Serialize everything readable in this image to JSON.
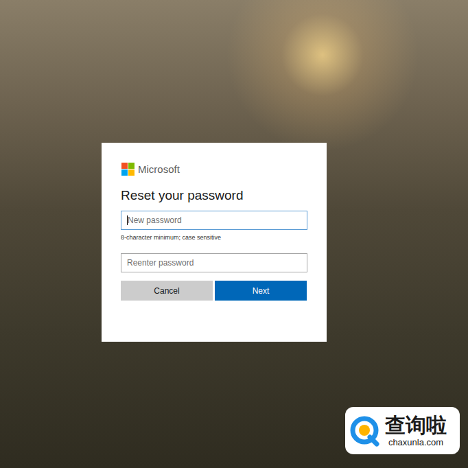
{
  "brand": "Microsoft",
  "title": "Reset your password",
  "fields": [
    {
      "placeholder": "New password",
      "hint": "8-character minimum; case sensitive",
      "focused": true
    },
    {
      "placeholder": "Reenter password",
      "hint": "",
      "focused": false
    }
  ],
  "buttons": [
    {
      "label": "Cancel",
      "primary": false
    },
    {
      "label": "Next",
      "primary": true
    }
  ],
  "watermark": {
    "name": "查询啦",
    "url": "chaxunla.com"
  }
}
